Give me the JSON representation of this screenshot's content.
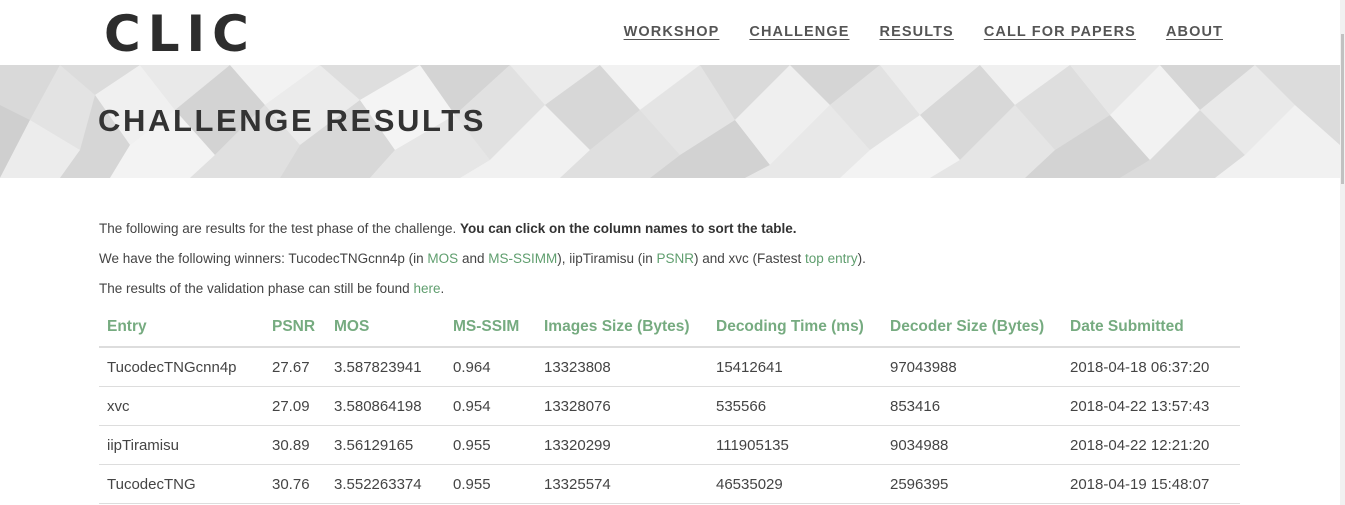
{
  "header": {
    "logo": "CLIC",
    "nav": [
      {
        "label": "WORKSHOP"
      },
      {
        "label": "CHALLENGE"
      },
      {
        "label": "RESULTS"
      },
      {
        "label": "CALL FOR PAPERS"
      },
      {
        "label": "ABOUT"
      }
    ]
  },
  "banner": {
    "title": "CHALLENGE RESULTS"
  },
  "intro": {
    "line1_text": "The following are results for the test phase of the challenge. ",
    "line1_bold": "You can click on the column names to sort the table.",
    "line2_a": "We have the following winners: TucodecTNGcnn4p (in ",
    "line2_link1": "MOS",
    "line2_b": " and ",
    "line2_link2": "MS-SSIMM",
    "line2_c": "), iipTiramisu (in ",
    "line2_link3": "PSNR",
    "line2_d": ") and xvc (Fastest ",
    "line2_link4": "top entry",
    "line2_e": ").",
    "line3_a": "The results of the validation phase can still be found ",
    "line3_link": "here",
    "line3_b": "."
  },
  "table": {
    "headers": [
      "Entry",
      "PSNR",
      "MOS",
      "MS-SSIM",
      "Images Size (Bytes)",
      "Decoding Time (ms)",
      "Decoder Size (Bytes)",
      "Date Submitted"
    ],
    "rows": [
      [
        "TucodecTNGcnn4p",
        "27.67",
        "3.587823941",
        "0.964",
        "13323808",
        "15412641",
        "97043988",
        "2018-04-18 06:37:20"
      ],
      [
        "xvc",
        "27.09",
        "3.580864198",
        "0.954",
        "13328076",
        "535566",
        "853416",
        "2018-04-22 13:57:43"
      ],
      [
        "iipTiramisu",
        "30.89",
        "3.56129165",
        "0.955",
        "13320299",
        "111905135",
        "9034988",
        "2018-04-22 12:21:20"
      ],
      [
        "TucodecTNG",
        "30.76",
        "3.552263374",
        "0.955",
        "13325574",
        "46535029",
        "2596395",
        "2018-04-19 15:48:07"
      ]
    ]
  },
  "colors": {
    "link": "#5f9e6e",
    "table_header": "#76ab80",
    "banner_bg": "#e6e6e6"
  }
}
